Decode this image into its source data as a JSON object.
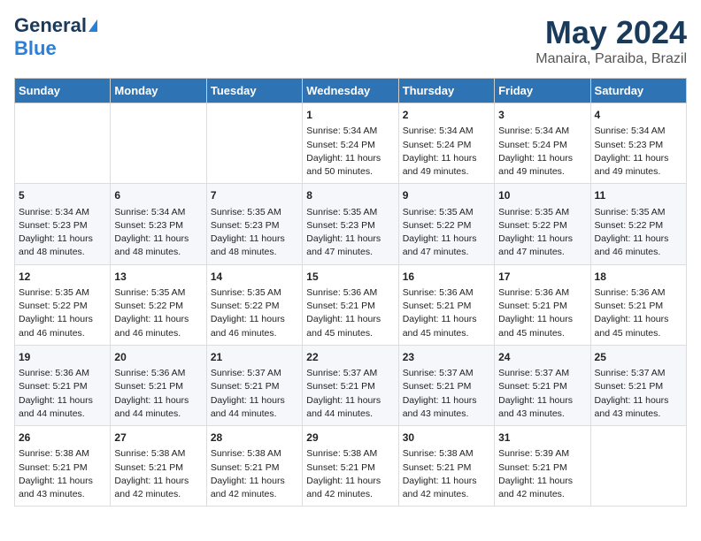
{
  "header": {
    "logo_general": "General",
    "logo_blue": "Blue",
    "month_year": "May 2024",
    "location": "Manaira, Paraiba, Brazil"
  },
  "days_of_week": [
    "Sunday",
    "Monday",
    "Tuesday",
    "Wednesday",
    "Thursday",
    "Friday",
    "Saturday"
  ],
  "weeks": [
    [
      {
        "day": "",
        "content": ""
      },
      {
        "day": "",
        "content": ""
      },
      {
        "day": "",
        "content": ""
      },
      {
        "day": "1",
        "content": "Sunrise: 5:34 AM\nSunset: 5:24 PM\nDaylight: 11 hours\nand 50 minutes."
      },
      {
        "day": "2",
        "content": "Sunrise: 5:34 AM\nSunset: 5:24 PM\nDaylight: 11 hours\nand 49 minutes."
      },
      {
        "day": "3",
        "content": "Sunrise: 5:34 AM\nSunset: 5:24 PM\nDaylight: 11 hours\nand 49 minutes."
      },
      {
        "day": "4",
        "content": "Sunrise: 5:34 AM\nSunset: 5:23 PM\nDaylight: 11 hours\nand 49 minutes."
      }
    ],
    [
      {
        "day": "5",
        "content": "Sunrise: 5:34 AM\nSunset: 5:23 PM\nDaylight: 11 hours\nand 48 minutes."
      },
      {
        "day": "6",
        "content": "Sunrise: 5:34 AM\nSunset: 5:23 PM\nDaylight: 11 hours\nand 48 minutes."
      },
      {
        "day": "7",
        "content": "Sunrise: 5:35 AM\nSunset: 5:23 PM\nDaylight: 11 hours\nand 48 minutes."
      },
      {
        "day": "8",
        "content": "Sunrise: 5:35 AM\nSunset: 5:23 PM\nDaylight: 11 hours\nand 47 minutes."
      },
      {
        "day": "9",
        "content": "Sunrise: 5:35 AM\nSunset: 5:22 PM\nDaylight: 11 hours\nand 47 minutes."
      },
      {
        "day": "10",
        "content": "Sunrise: 5:35 AM\nSunset: 5:22 PM\nDaylight: 11 hours\nand 47 minutes."
      },
      {
        "day": "11",
        "content": "Sunrise: 5:35 AM\nSunset: 5:22 PM\nDaylight: 11 hours\nand 46 minutes."
      }
    ],
    [
      {
        "day": "12",
        "content": "Sunrise: 5:35 AM\nSunset: 5:22 PM\nDaylight: 11 hours\nand 46 minutes."
      },
      {
        "day": "13",
        "content": "Sunrise: 5:35 AM\nSunset: 5:22 PM\nDaylight: 11 hours\nand 46 minutes."
      },
      {
        "day": "14",
        "content": "Sunrise: 5:35 AM\nSunset: 5:22 PM\nDaylight: 11 hours\nand 46 minutes."
      },
      {
        "day": "15",
        "content": "Sunrise: 5:36 AM\nSunset: 5:21 PM\nDaylight: 11 hours\nand 45 minutes."
      },
      {
        "day": "16",
        "content": "Sunrise: 5:36 AM\nSunset: 5:21 PM\nDaylight: 11 hours\nand 45 minutes."
      },
      {
        "day": "17",
        "content": "Sunrise: 5:36 AM\nSunset: 5:21 PM\nDaylight: 11 hours\nand 45 minutes."
      },
      {
        "day": "18",
        "content": "Sunrise: 5:36 AM\nSunset: 5:21 PM\nDaylight: 11 hours\nand 45 minutes."
      }
    ],
    [
      {
        "day": "19",
        "content": "Sunrise: 5:36 AM\nSunset: 5:21 PM\nDaylight: 11 hours\nand 44 minutes."
      },
      {
        "day": "20",
        "content": "Sunrise: 5:36 AM\nSunset: 5:21 PM\nDaylight: 11 hours\nand 44 minutes."
      },
      {
        "day": "21",
        "content": "Sunrise: 5:37 AM\nSunset: 5:21 PM\nDaylight: 11 hours\nand 44 minutes."
      },
      {
        "day": "22",
        "content": "Sunrise: 5:37 AM\nSunset: 5:21 PM\nDaylight: 11 hours\nand 44 minutes."
      },
      {
        "day": "23",
        "content": "Sunrise: 5:37 AM\nSunset: 5:21 PM\nDaylight: 11 hours\nand 43 minutes."
      },
      {
        "day": "24",
        "content": "Sunrise: 5:37 AM\nSunset: 5:21 PM\nDaylight: 11 hours\nand 43 minutes."
      },
      {
        "day": "25",
        "content": "Sunrise: 5:37 AM\nSunset: 5:21 PM\nDaylight: 11 hours\nand 43 minutes."
      }
    ],
    [
      {
        "day": "26",
        "content": "Sunrise: 5:38 AM\nSunset: 5:21 PM\nDaylight: 11 hours\nand 43 minutes."
      },
      {
        "day": "27",
        "content": "Sunrise: 5:38 AM\nSunset: 5:21 PM\nDaylight: 11 hours\nand 42 minutes."
      },
      {
        "day": "28",
        "content": "Sunrise: 5:38 AM\nSunset: 5:21 PM\nDaylight: 11 hours\nand 42 minutes."
      },
      {
        "day": "29",
        "content": "Sunrise: 5:38 AM\nSunset: 5:21 PM\nDaylight: 11 hours\nand 42 minutes."
      },
      {
        "day": "30",
        "content": "Sunrise: 5:38 AM\nSunset: 5:21 PM\nDaylight: 11 hours\nand 42 minutes."
      },
      {
        "day": "31",
        "content": "Sunrise: 5:39 AM\nSunset: 5:21 PM\nDaylight: 11 hours\nand 42 minutes."
      },
      {
        "day": "",
        "content": ""
      }
    ]
  ]
}
